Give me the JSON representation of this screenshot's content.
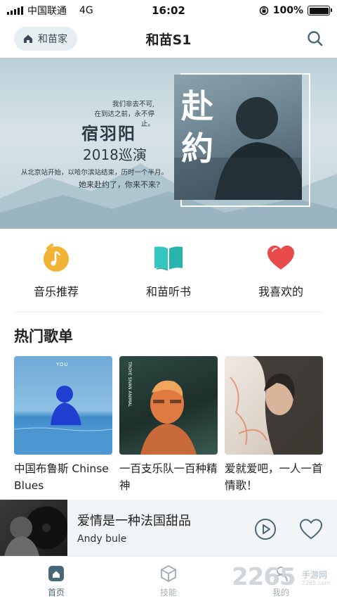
{
  "status_bar": {
    "carrier": "中国联通",
    "network": "4G",
    "time": "16:02",
    "battery": "100%",
    "battery_level": 1.0
  },
  "header": {
    "home_label": "和苗家",
    "title": "和苗S1",
    "search_icon": "search-icon"
  },
  "banner": {
    "lines": [
      "我们非去不可,",
      "在到达之前，永不停止。"
    ],
    "artist": "宿羽阳",
    "tour": "2018巡演",
    "subline": "从北京站开始，以哈尔滨站结束，历时一个半月。",
    "quote": "她来赴约了，你来不来?",
    "photo_text": [
      "赴",
      "約"
    ]
  },
  "quick_entries": [
    {
      "label": "音乐推荐",
      "icon": "music-clock-icon",
      "color": "#f2b233"
    },
    {
      "label": "和苗听书",
      "icon": "open-book-icon",
      "color": "#33c6c0"
    },
    {
      "label": "我喜欢的",
      "icon": "heart-icon",
      "color": "#e94a4a"
    }
  ],
  "hot_playlists": {
    "title": "热门歌单",
    "items": [
      {
        "name": "中国布鲁斯 Chinse Blues",
        "cover_text": "YOU"
      },
      {
        "name": "一百支乐队一百种精神",
        "cover_text": "TROYE SIVAN ANIMAL"
      },
      {
        "name": "爱就爱吧，一人一首情歌！",
        "cover_text": ""
      }
    ]
  },
  "now_playing": {
    "title": "爱情是一种法国甜品",
    "artist": "Andy bule",
    "play_icon": "play-circle-icon",
    "like_icon": "heart-outline-icon"
  },
  "tabs": [
    {
      "label": "首页",
      "icon": "home-icon",
      "active": true
    },
    {
      "label": "技能",
      "icon": "cube-icon",
      "active": false
    },
    {
      "label": "我的",
      "icon": "user-icon",
      "active": false
    }
  ],
  "watermark": {
    "number": "2265",
    "brand": "手游网",
    "url": "2265.com"
  },
  "colors": {
    "accent": "#4a6879",
    "pill_bg": "#e7eef1",
    "player_bg": "#f1f5f7",
    "tab_inactive": "#a7b0b6"
  }
}
